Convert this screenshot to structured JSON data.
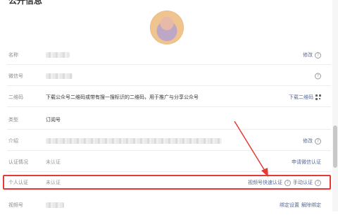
{
  "section_title": "公开信息",
  "rows": [
    {
      "label": "名称",
      "actions": [
        {
          "text": "修改",
          "type": "link"
        },
        {
          "type": "help"
        }
      ]
    },
    {
      "label": "微信号",
      "actions": [
        {
          "type": "help"
        }
      ]
    },
    {
      "label": "二维码",
      "value": "下载公众号二维码或带有搜一搜标识的二维码，用于推广与分享公众号",
      "actions": [
        {
          "text": "下载二维码",
          "type": "link"
        },
        {
          "type": "qr"
        }
      ]
    },
    {
      "label": "类型",
      "value": "订阅号"
    },
    {
      "label": "介绍",
      "actions": [
        {
          "text": "修改",
          "type": "link"
        },
        {
          "type": "help"
        }
      ]
    },
    {
      "label": "认证情况",
      "value": "未认证",
      "actions": [
        {
          "text": "申请微信认证",
          "type": "link"
        }
      ]
    },
    {
      "label": "个人认证",
      "value": "未认证",
      "actions": [
        {
          "text": "视频号快速认证",
          "type": "link"
        },
        {
          "type": "help"
        },
        {
          "text": "手动认证",
          "type": "link"
        },
        {
          "type": "help"
        }
      ]
    },
    {
      "label": "视频号",
      "actions": [
        {
          "text": "绑定设置",
          "type": "link"
        },
        {
          "text": "解除绑定",
          "type": "link"
        }
      ]
    }
  ],
  "help_glyph": "?",
  "accent_color": "#576b95",
  "highlight_color": "#e53935"
}
